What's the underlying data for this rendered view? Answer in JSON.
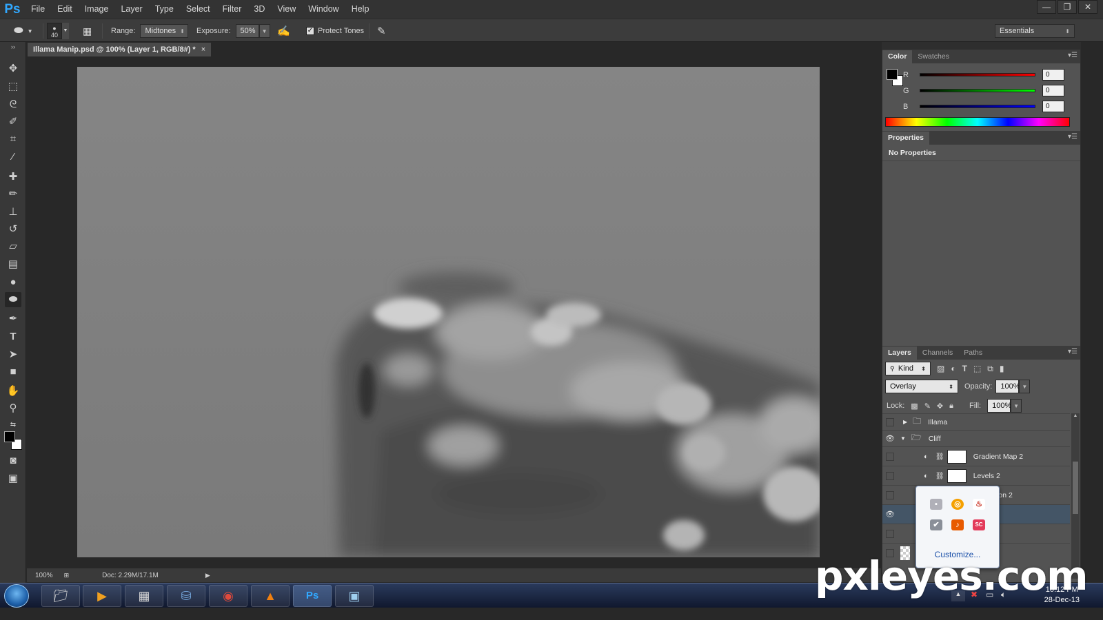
{
  "app": {
    "logo": "Ps"
  },
  "menu": [
    "File",
    "Edit",
    "Image",
    "Layer",
    "Type",
    "Select",
    "Filter",
    "3D",
    "View",
    "Window",
    "Help"
  ],
  "window_controls": {
    "minimize": "—",
    "restore": "❐",
    "close": "✕"
  },
  "options": {
    "brush_size": "40",
    "range_label": "Range:",
    "range_value": "Midtones",
    "exposure_label": "Exposure:",
    "exposure_value": "50%",
    "protect_tones": "Protect Tones",
    "workspace": "Essentials"
  },
  "document": {
    "tab_title": "Illama Manip.psd @ 100% (Layer 1, RGB/8#) *",
    "close_glyph": "×"
  },
  "status": {
    "zoom": "100%",
    "doc_size": "Doc: 2.29M/17.1M"
  },
  "color_panel": {
    "tabs": [
      "Color",
      "Swatches"
    ],
    "channels": [
      {
        "label": "R",
        "value": "0",
        "color": "#e01010"
      },
      {
        "label": "G",
        "value": "0",
        "color": "#10c010"
      },
      {
        "label": "B",
        "value": "0",
        "color": "#1030e0"
      }
    ]
  },
  "properties_panel": {
    "tab": "Properties",
    "empty_text": "No Properties"
  },
  "layers_panel": {
    "tabs": [
      "Layers",
      "Channels",
      "Paths"
    ],
    "filter_kind": "Kind",
    "blend_mode": "Overlay",
    "opacity_label": "Opacity:",
    "opacity_value": "100%",
    "lock_label": "Lock:",
    "fill_label": "Fill:",
    "fill_value": "100%",
    "layers": [
      {
        "name": "Illama",
        "type": "group",
        "visible": false,
        "expanded": false
      },
      {
        "name": "Cliff",
        "type": "group",
        "visible": true,
        "expanded": true
      },
      {
        "name": "Gradient Map 2",
        "type": "adjustment",
        "visible": false
      },
      {
        "name": "Levels 2",
        "type": "adjustment",
        "visible": false
      },
      {
        "name": "uration 2",
        "type": "adjustment",
        "visible": false
      },
      {
        "name": "",
        "type": "pixel",
        "visible": true,
        "selected": true
      },
      {
        "name": "",
        "type": "pixel",
        "visible": false
      },
      {
        "name": "",
        "type": "pixel",
        "visible": false
      }
    ]
  },
  "tray_popup": {
    "customize": "Customize..."
  },
  "taskbar": {
    "time": "10:12 PM",
    "date": "28-Dec-13"
  },
  "watermark": "pxleyes.com"
}
